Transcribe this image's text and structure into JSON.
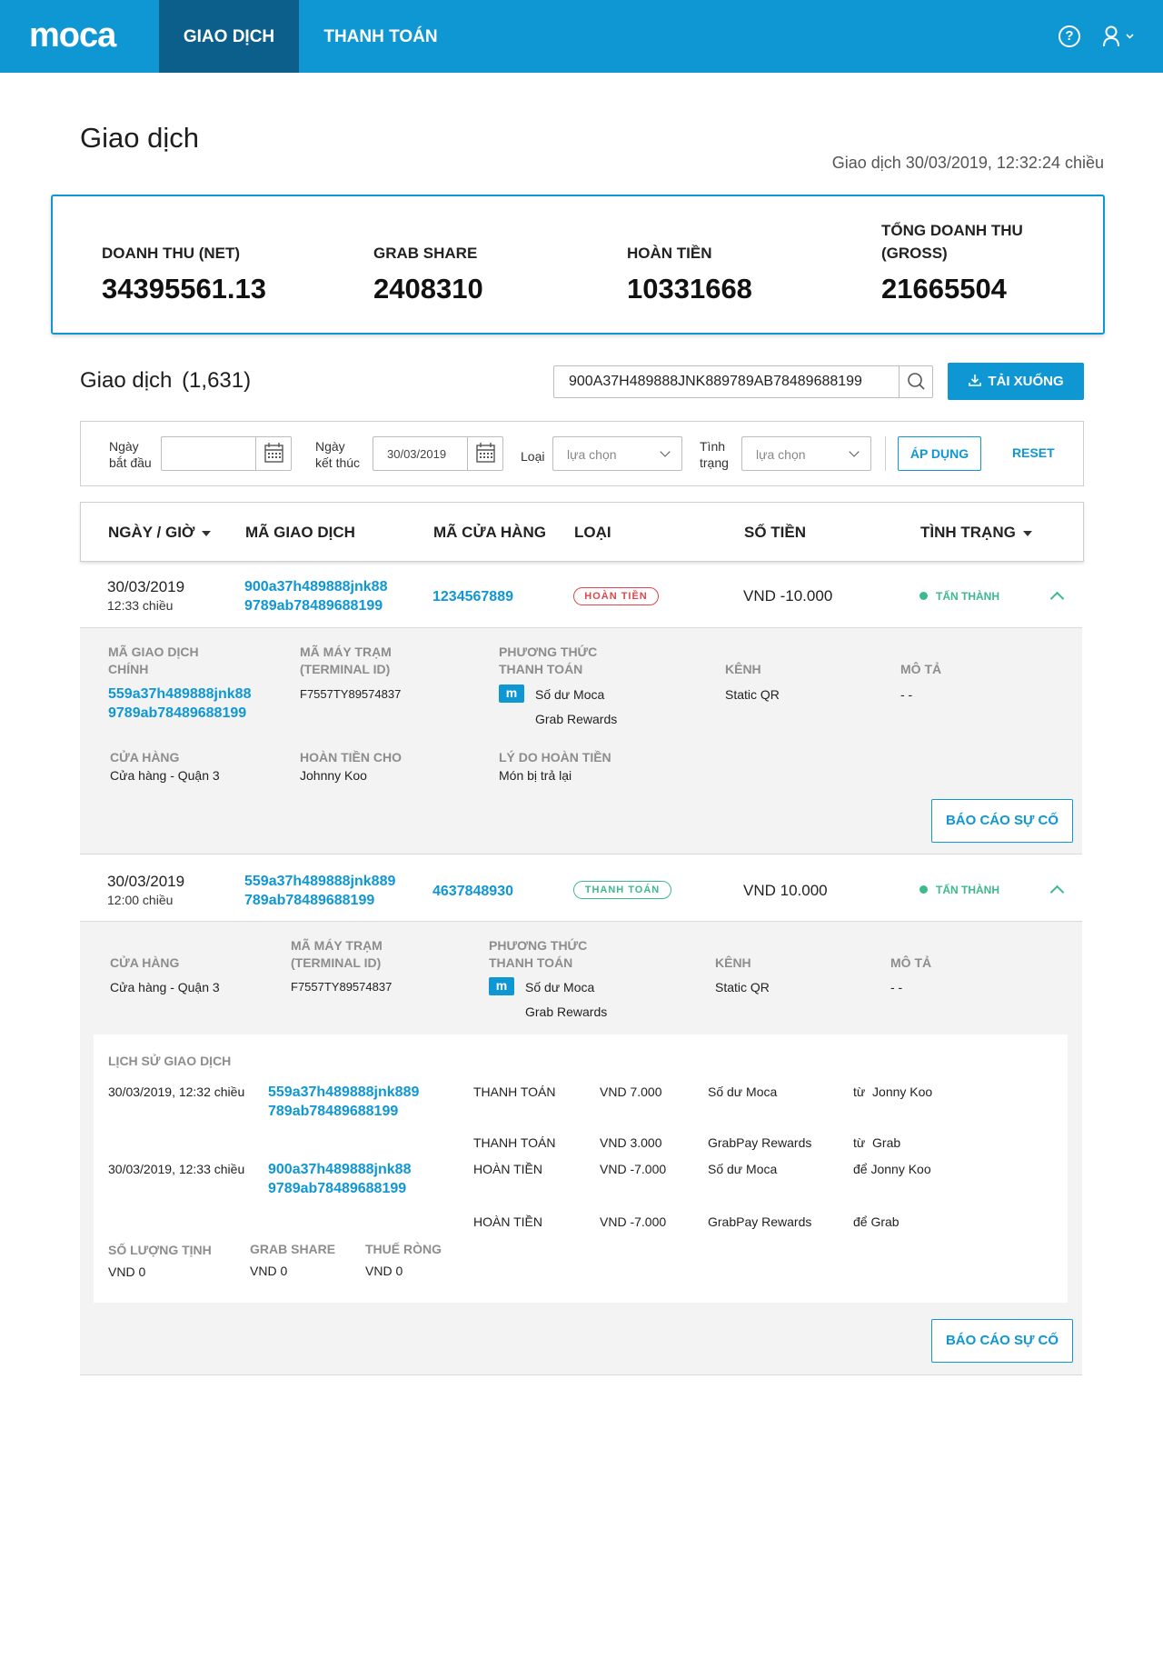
{
  "header": {
    "logo": "moca",
    "tabs": [
      "GIAO DỊCH",
      "THANH TOÁN"
    ],
    "help_icon": "?"
  },
  "page": {
    "title": "Giao dịch",
    "timestamp": "Giao dịch 30/03/2019, 12:32:24 chiều"
  },
  "summary": [
    {
      "label": "DOANH THU (NET)",
      "value": "34395561.13"
    },
    {
      "label": "GRAB SHARE",
      "value": "2408310"
    },
    {
      "label": "HOÀN TIỀN",
      "value": "10331668"
    },
    {
      "label_line1": "TỔNG DOANH THU",
      "label_line2": "(GROSS)",
      "value": "21665504"
    }
  ],
  "transactions": {
    "heading": "Giao dịch",
    "count": "(1,631)",
    "search_value": "900A37H489888JNK889789AB78489688199",
    "download_label": "TẢI XUỐNG"
  },
  "filters": {
    "start_label_1": "Ngày",
    "start_label_2": "bắt đầu",
    "start_value": "",
    "end_label_1": "Ngày",
    "end_label_2": "kết thúc",
    "end_value": "30/03/2019",
    "type_label": "Loại",
    "type_placeholder": "lựa chọn",
    "status_label_1": "Tình",
    "status_label_2": "trạng",
    "status_placeholder": "lựa chọn",
    "apply_label": "ÁP DỤNG",
    "reset_label": "RESET"
  },
  "table": {
    "columns": [
      "NGÀY / GIỜ",
      "MÃ GIAO DỊCH",
      "MÃ CỬA HÀNG",
      "LOẠI",
      "SỐ TIỀN",
      "TÌNH TRẠNG"
    ],
    "rows": [
      {
        "date": "30/03/2019",
        "time": "12:33 chiều",
        "tx_id_1": "900a37h489888jnk88",
        "tx_id_2": "9789ab78489688199",
        "store_id": "1234567889",
        "type": "HOÀN TIỀN",
        "amount": "VND -10.000",
        "status": "TẤN THÀNH",
        "detail": {
          "main_tx_label_1": "MÃ GIAO DỊCH",
          "main_tx_label_2": "CHÍNH",
          "main_tx_1": "559a37h489888jnk88",
          "main_tx_2": "9789ab78489688199",
          "terminal_label_1": "MÃ MÁY TRẠM",
          "terminal_label_2": "(TERMINAL ID)",
          "terminal": "F7557TY89574837",
          "method_label_1": "PHƯƠNG THỨC",
          "method_label_2": "THANH TOÁN",
          "method_icon": "m",
          "method_1": "Số dư Moca",
          "method_2": "Grab Rewards",
          "channel_label": "KÊNH",
          "channel": "Static QR",
          "desc_label": "MÔ TẢ",
          "desc": "- -",
          "store_label": "CỬA HÀNG",
          "store": "Cửa hàng - Quận 3",
          "refund_to_label": "HOÀN TIỀN CHO",
          "refund_to": "Johnny Koo",
          "reason_label": "LÝ DO HOÀN TIỀN",
          "reason": "Món bị trả lại",
          "report_label": "BÁO CÁO SỰ CỐ"
        }
      },
      {
        "date": "30/03/2019",
        "time": "12:00 chiều",
        "tx_id_1": "559a37h489888jnk889",
        "tx_id_2": "789ab78489688199",
        "store_id": "4637848930",
        "type": "THANH TOÁN",
        "amount": "VND 10.000",
        "status": "TẤN THÀNH",
        "detail": {
          "store_label": "CỬA HÀNG",
          "store": "Cửa hàng - Quận 3",
          "terminal_label_1": "MÃ MÁY TRẠM",
          "terminal_label_2": "(TERMINAL ID)",
          "terminal": "F7557TY89574837",
          "method_label_1": "PHƯƠNG THỨC",
          "method_label_2": "THANH TOÁN",
          "method_icon": "m",
          "method_1": "Số dư Moca",
          "method_2": "Grab Rewards",
          "channel_label": "KÊNH",
          "channel": "Static QR",
          "desc_label": "MÔ TẢ",
          "desc": "- -",
          "history": {
            "title": "LỊCH SỬ GIAO DỊCH",
            "entries": [
              {
                "time": "30/03/2019, 12:32 chiều",
                "id_1": "559a37h489888jnk889",
                "id_2": "789ab78489688199",
                "type": "THANH TOÁN",
                "amount": "VND 7.000",
                "source": "Số dư Moca",
                "party": "từ  Jonny Koo"
              },
              {
                "type": "THANH TOÁN",
                "amount": "VND 3.000",
                "source": "GrabPay Rewards",
                "party": "từ  Grab"
              },
              {
                "time": "30/03/2019, 12:33 chiều",
                "id_1": "900a37h489888jnk88",
                "id_2": "9789ab78489688199",
                "type": "HOÀN TIỀN",
                "amount": "VND -7.000",
                "source": "Số dư Moca",
                "party": "để Jonny Koo"
              },
              {
                "type": "HOÀN TIỀN",
                "amount": "VND -7.000",
                "source": "GrabPay Rewards",
                "party": "để Grab"
              }
            ],
            "net_qty_label": "SỐ LƯỢNG TỊNH",
            "net_qty": "VND 0",
            "grab_share_label": "GRAB SHARE",
            "grab_share": "VND 0",
            "net_tax_label": "THUẾ RÒNG",
            "net_tax": "VND 0"
          },
          "report_label": "BÁO CÁO SỰ CỐ"
        }
      }
    ]
  },
  "colors": {
    "brand": "#0f97d4",
    "nav_active": "#0b5f8a",
    "refund": "#e0464b",
    "success": "#3cba8b"
  }
}
